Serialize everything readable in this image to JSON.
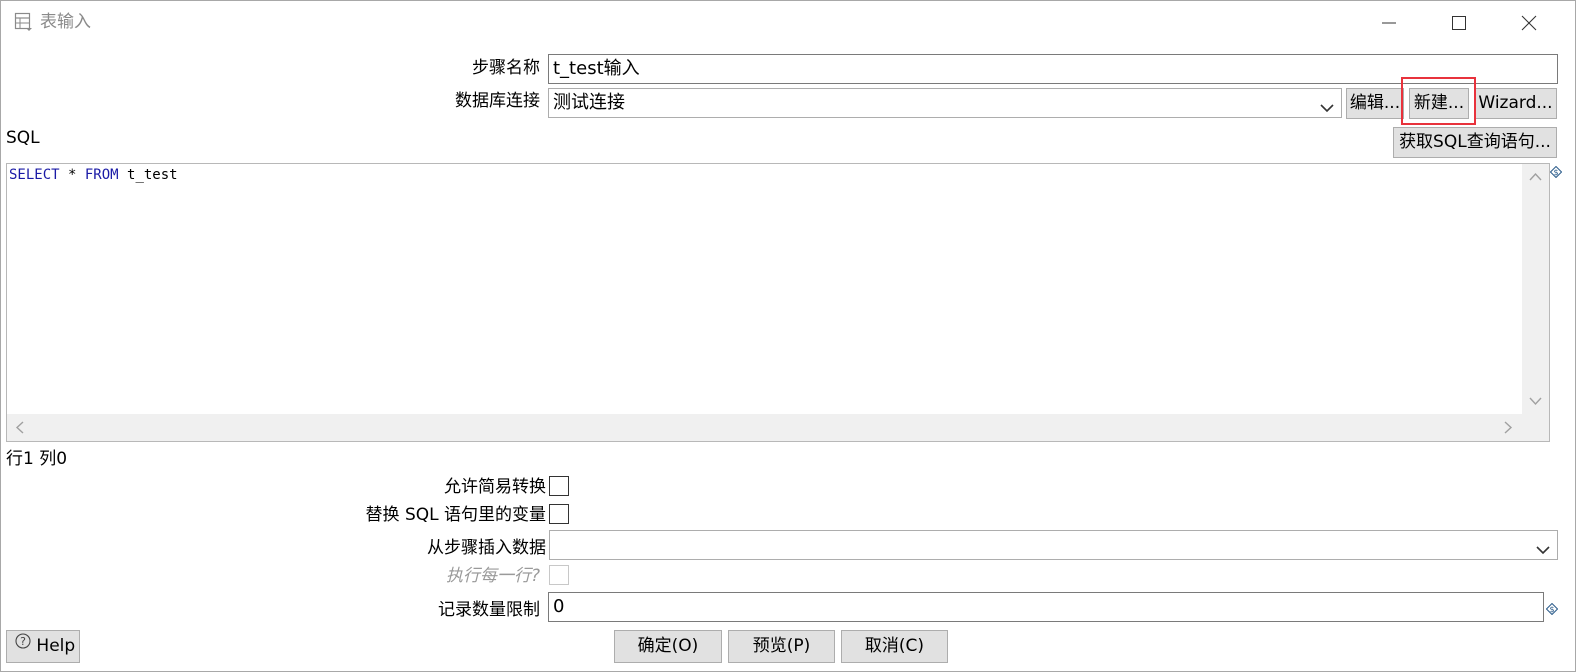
{
  "window": {
    "title": "表输入",
    "icon": "table-input-icon",
    "controls": [
      "minimize-icon",
      "maximize-icon",
      "close-icon"
    ]
  },
  "form": {
    "step_name_label": "步骤名称",
    "step_name_value": "t_test输入",
    "db_connection_label": "数据库连接",
    "db_connection_value": "测试连接",
    "edit_button": "编辑...",
    "new_button": "新建...",
    "wizard_button": "Wizard...",
    "sql_label": "SQL",
    "get_sql_button": "获取SQL查询语句..."
  },
  "sql_editor": {
    "keyword_select": "SELECT",
    "star": " * ",
    "keyword_from": "FROM",
    "table": " t_test"
  },
  "cursor_position": "行1 列0",
  "options": {
    "lazy_conversion_label": "允许简易转换",
    "lazy_conversion_checked": false,
    "replace_vars_label": "替换 SQL 语句里的变量",
    "replace_vars_checked": false,
    "insert_from_step_label": "从步骤插入数据",
    "insert_from_step_value": "",
    "execute_each_row_label": "执行每一行?",
    "execute_each_row_checked": false,
    "limit_label": "记录数量限制",
    "limit_value": "0"
  },
  "footer": {
    "help_button": "Help",
    "ok_button": "确定(O)",
    "preview_button": "预览(P)",
    "cancel_button": "取消(C)"
  },
  "colors": {
    "highlight_box": "#e8323c",
    "sql_keyword": "#1a1aa6",
    "button_face": "#e1e1e1"
  }
}
